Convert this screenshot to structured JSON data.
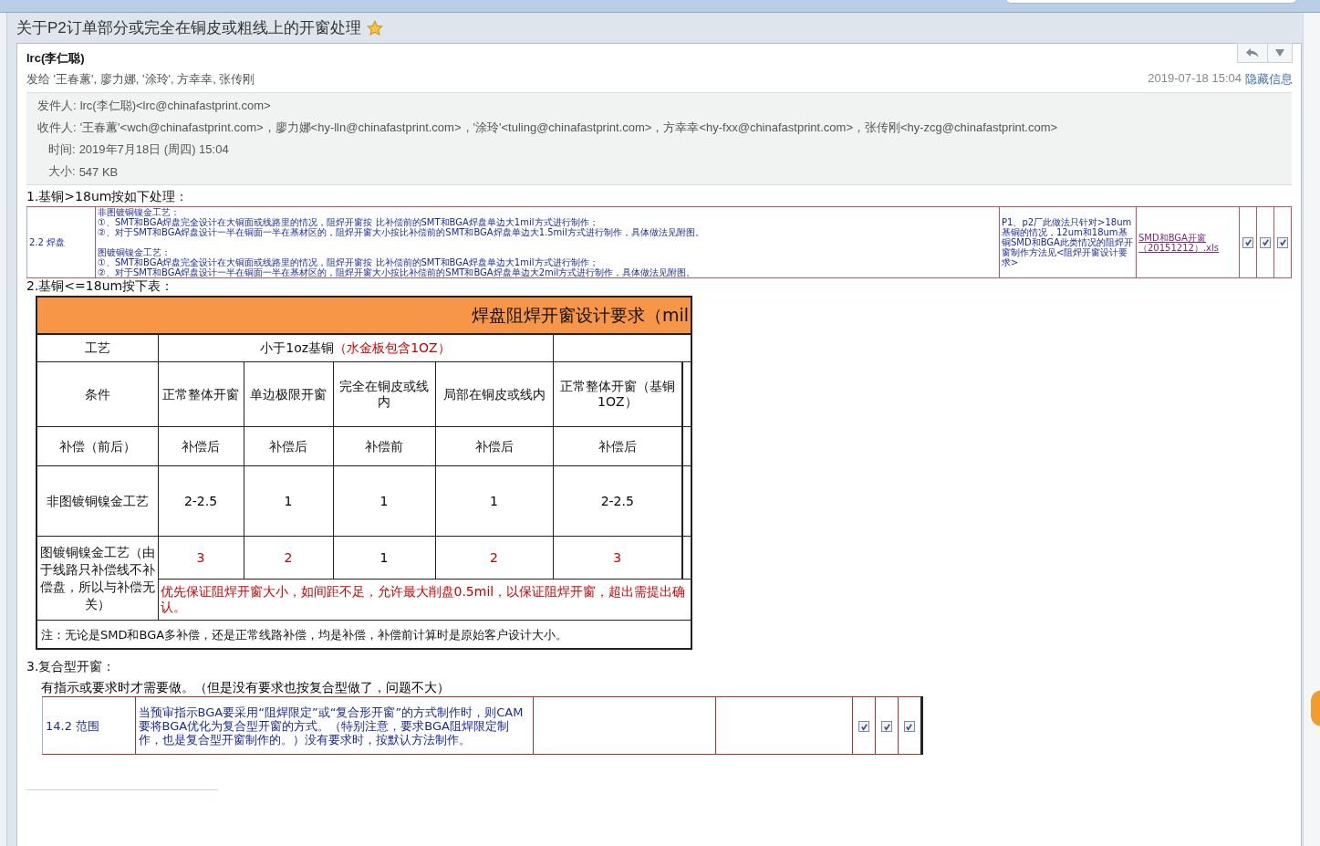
{
  "subject": {
    "title": "关于P2订单部分或完全在铜皮或粗线上的开窗处理",
    "starred": true
  },
  "header": {
    "sender": "lrc(李仁聪)",
    "recipients": "发给 '王春蕙', 廖力娜, '涂玲', 方幸幸, 张传刚",
    "date": "2019-07-18 15:04",
    "hide_link": "隐藏信息"
  },
  "details": [
    {
      "label": "发件人:",
      "value": "lrc(李仁聪)<lrc@chinafastprint.com>"
    },
    {
      "label": "收件人:",
      "value": "'王春蕙'<wch@chinafastprint.com>，廖力娜<hy-lln@chinafastprint.com>，'涂玲'<tuling@chinafastprint.com>，方幸幸<hy-fxx@chinafastprint.com>，张传刚<hy-zcg@chinafastprint.com>"
    },
    {
      "label": "时间:",
      "value": "2019年7月18日 (周四) 15:04"
    },
    {
      "label": "大小:",
      "value": "547 KB"
    }
  ],
  "body": {
    "heading1": "1.基铜>18um按如下处理：",
    "table1": {
      "item": "2.2 焊盘",
      "lines": [
        "非图镀铜镍金工艺：",
        "①、SMT和BGA焊盘完全设计在大铜面或线路里的情况，阻焊开窗按 比补偿前的SMT和BGA焊盘单边大1mil方式进行制作；",
        "②、对于SMT和BGA焊盘设计一半在铜面一半在基材区的，阻焊开窗大小按比补偿前的SMT和BGA焊盘单边大1.5mil方式进行制作，具体做法见附图。",
        "图镀铜镍金工艺：",
        "①、SMT和BGA焊盘完全设计在大铜面或线路里的情况，阻焊开窗按 比补偿前的SMT和BGA焊盘单边大1mil方式进行制作；",
        "②、对于SMT和BGA焊盘设计一半在铜面一半在基材区的，阻焊开窗大小按比补偿前的SMT和BGA焊盘单边大2mil方式进行制作，具体做法见附图。"
      ],
      "remark": "P1、p2厂此做法只针对>18um基铜的情况，12um和18um基铜SMD和BGA此类情况的阻焊开窗制作方法见<阻焊开窗设计要求>",
      "attachment": "SMD和BGA开窗（20151212）.xls",
      "checks": [
        {
          "checked": true
        },
        {
          "checked": true
        },
        {
          "checked": true
        }
      ]
    },
    "heading2": "2.基铜<=18um按下表：",
    "table2": {
      "title": "焊盘阻焊开窗设计要求（mil",
      "process_label": "工艺",
      "process_value": "小于1oz基铜",
      "process_note": "（水金板包含1OZ）",
      "conditions_label": "条件",
      "conditions": [
        "正常整体开窗",
        "单边极限开窗",
        "完全在铜皮或线内",
        "局部在铜皮或线内",
        "正常整体开窗（基铜1OZ）"
      ],
      "comp_label": "补偿（前后）",
      "comp": [
        "补偿后",
        "补偿后",
        "补偿前",
        "补偿后",
        "补偿后"
      ],
      "rows": [
        {
          "label": "非图镀铜镍金工艺",
          "cells": [
            {
              "text": "2-2.5",
              "color": "#000000"
            },
            {
              "text": "1",
              "color": "#000000"
            },
            {
              "text": "1",
              "color": "#000000"
            },
            {
              "text": "1",
              "color": "#000000"
            },
            {
              "text": "2-2.5",
              "color": "#000000"
            }
          ]
        },
        {
          "label": "图镀铜镍金工艺（由于线路只补偿线不补偿盘，所以与补偿无关）",
          "cells": [
            {
              "text": "3",
              "color": "#cc0000"
            },
            {
              "text": "2",
              "color": "#cc0000"
            },
            {
              "text": "1",
              "color": "#000000"
            },
            {
              "text": "2",
              "color": "#cc0000"
            },
            {
              "text": "3",
              "color": "#cc0000"
            }
          ],
          "note": "优先保证阻焊开窗大小，如间距不足，允许最大削盘0.5mil，以保证阻焊开窗，超出需提出确认。"
        }
      ],
      "footnote": "注：无论是SMD和BGA多补偿，还是正常线路补偿，均是补偿，补偿前计算时是原始客户设计大小。"
    },
    "heading3": "3.复合型开窗：",
    "intro3": "有指示或要求时才需要做。（但是没有要求也按复合型做了，问题不大）",
    "table3": {
      "item": "14.2 范围",
      "text": "当预审指示BGA要采用“阻焊限定”或“复合形开窗”的方式制作时，则CAM要将BGA优化为复合型开窗的方式。（特别注意，要求BGA阻焊限定制作，也是复合型开窗制作的。）没有要求时，按默认方法制作。",
      "checks": [
        {
          "checked": true
        },
        {
          "checked": true
        },
        {
          "checked": true
        }
      ]
    }
  }
}
